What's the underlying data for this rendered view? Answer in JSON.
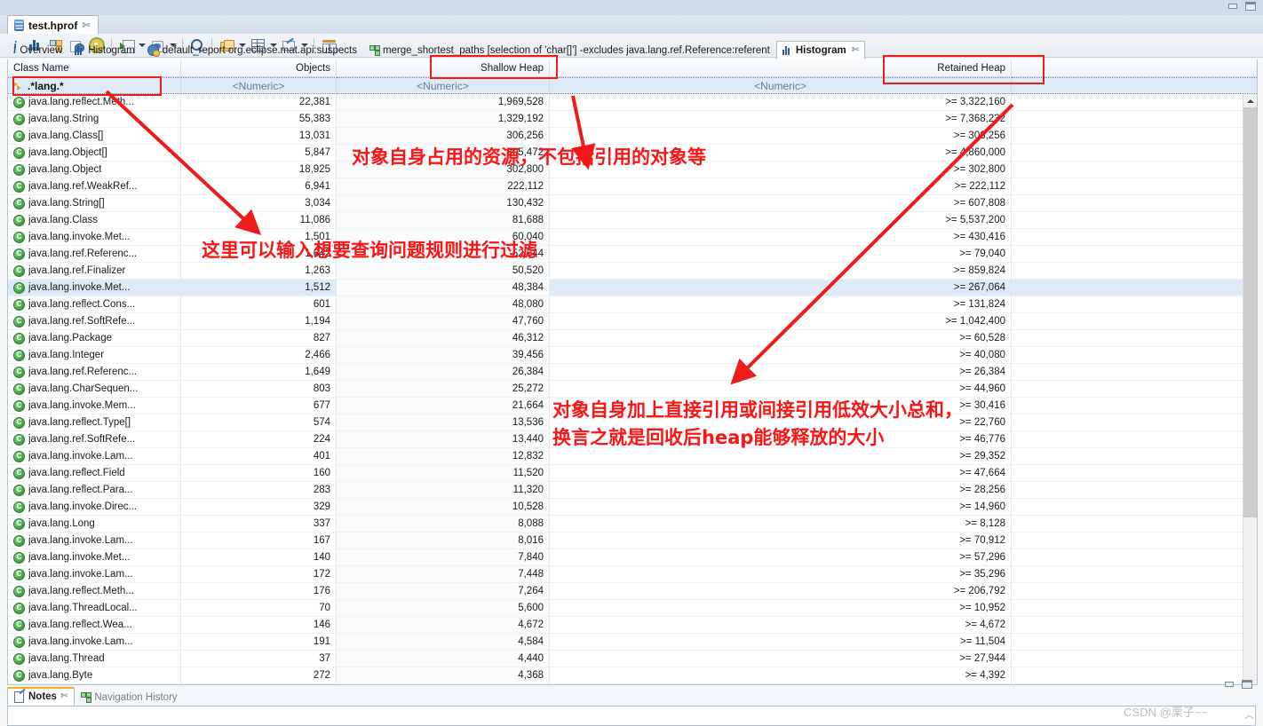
{
  "window": {
    "minimize_label": "minimize",
    "maximize_label": "maximize"
  },
  "editor_tab": {
    "title": "test.hprof",
    "close_glyph": "✄"
  },
  "toolbar": {
    "items": [
      {
        "name": "overview-info",
        "label": "i"
      },
      {
        "name": "histogram",
        "label": "Histogram"
      },
      {
        "name": "dominator-tree",
        "label": "Dominator Tree"
      },
      {
        "name": "oql",
        "label": "OQL"
      },
      {
        "name": "leak-suspects",
        "label": "Leak Suspects"
      },
      {
        "name": "run-expert-system",
        "label": "Run Expert System Test"
      },
      {
        "name": "query-browser",
        "label": "Query Browser"
      },
      {
        "name": "find-object",
        "label": "Find Object by Address"
      },
      {
        "name": "group-by",
        "label": "Group by"
      },
      {
        "name": "calculate-retained",
        "label": "Calculate Retained Size"
      },
      {
        "name": "export",
        "label": "Export"
      },
      {
        "name": "compare",
        "label": "Compare to another Heap Dump"
      }
    ]
  },
  "view_tabs": [
    {
      "label": "Overview",
      "icon": "info-icon",
      "selected": false,
      "closable": false
    },
    {
      "label": "Histogram",
      "icon": "histogram-icon",
      "selected": false,
      "closable": false
    },
    {
      "label": "default_report org.eclipse.mat.api:suspects",
      "icon": "report-icon",
      "selected": false,
      "closable": false
    },
    {
      "label": "merge_shortest_paths [selection of 'char[]'] -excludes java.lang.ref.Reference:referent",
      "icon": "tree-icon",
      "selected": false,
      "closable": false
    },
    {
      "label": "Histogram",
      "icon": "histogram-icon",
      "selected": true,
      "closable": true,
      "close_glyph": "✄"
    }
  ],
  "table": {
    "columns": [
      "Class Name",
      "Objects",
      "Shallow Heap",
      "Retained Heap",
      ""
    ],
    "filter_row": {
      "class_name": ".*lang.*",
      "objects": "<Numeric>",
      "shallow": "<Numeric>",
      "retained": "<Numeric>"
    },
    "rows": [
      {
        "class": "java.lang.reflect.Meth...",
        "objects": "22,381",
        "shallow": "1,969,528",
        "retained": ">= 3,322,160",
        "selected": false
      },
      {
        "class": "java.lang.String",
        "objects": "55,383",
        "shallow": "1,329,192",
        "retained": ">= 7,368,232",
        "selected": false
      },
      {
        "class": "java.lang.Class[]",
        "objects": "13,031",
        "shallow": "306,256",
        "retained": ">= 306,256",
        "selected": false
      },
      {
        "class": "java.lang.Object[]",
        "objects": "5,847",
        "shallow": "305,472",
        "retained": ">= 4,860,000",
        "selected": false
      },
      {
        "class": "java.lang.Object",
        "objects": "18,925",
        "shallow": "302,800",
        "retained": ">= 302,800",
        "selected": false
      },
      {
        "class": "java.lang.ref.WeakRef...",
        "objects": "6,941",
        "shallow": "222,112",
        "retained": ">= 222,112",
        "selected": false
      },
      {
        "class": "java.lang.String[]",
        "objects": "3,034",
        "shallow": "130,432",
        "retained": ">= 607,808",
        "selected": false
      },
      {
        "class": "java.lang.Class",
        "objects": "11,086",
        "shallow": "81,688",
        "retained": ">= 5,537,200",
        "selected": false
      },
      {
        "class": "java.lang.invoke.Met...",
        "objects": "1,501",
        "shallow": "60,040",
        "retained": ">= 430,416",
        "selected": false
      },
      {
        "class": "java.lang.ref.Referenc...",
        "objects": "1,642",
        "shallow": "52,544",
        "retained": ">= 79,040",
        "selected": false
      },
      {
        "class": "java.lang.ref.Finalizer",
        "objects": "1,263",
        "shallow": "50,520",
        "retained": ">= 859,824",
        "selected": false
      },
      {
        "class": "java.lang.invoke.Met...",
        "objects": "1,512",
        "shallow": "48,384",
        "retained": ">= 267,064",
        "selected": true
      },
      {
        "class": "java.lang.reflect.Cons...",
        "objects": "601",
        "shallow": "48,080",
        "retained": ">= 131,824",
        "selected": false
      },
      {
        "class": "java.lang.ref.SoftRefe...",
        "objects": "1,194",
        "shallow": "47,760",
        "retained": ">= 1,042,400",
        "selected": false
      },
      {
        "class": "java.lang.Package",
        "objects": "827",
        "shallow": "46,312",
        "retained": ">= 60,528",
        "selected": false
      },
      {
        "class": "java.lang.Integer",
        "objects": "2,466",
        "shallow": "39,456",
        "retained": ">= 40,080",
        "selected": false
      },
      {
        "class": "java.lang.ref.Referenc...",
        "objects": "1,649",
        "shallow": "26,384",
        "retained": ">= 26,384",
        "selected": false
      },
      {
        "class": "java.lang.CharSequen...",
        "objects": "803",
        "shallow": "25,272",
        "retained": ">= 44,960",
        "selected": false
      },
      {
        "class": "java.lang.invoke.Mem...",
        "objects": "677",
        "shallow": "21,664",
        "retained": ">= 30,416",
        "selected": false
      },
      {
        "class": "java.lang.reflect.Type[]",
        "objects": "574",
        "shallow": "13,536",
        "retained": ">= 22,760",
        "selected": false
      },
      {
        "class": "java.lang.ref.SoftRefe...",
        "objects": "224",
        "shallow": "13,440",
        "retained": ">= 46,776",
        "selected": false
      },
      {
        "class": "java.lang.invoke.Lam...",
        "objects": "401",
        "shallow": "12,832",
        "retained": ">= 29,352",
        "selected": false
      },
      {
        "class": "java.lang.reflect.Field",
        "objects": "160",
        "shallow": "11,520",
        "retained": ">= 47,664",
        "selected": false
      },
      {
        "class": "java.lang.reflect.Para...",
        "objects": "283",
        "shallow": "11,320",
        "retained": ">= 28,256",
        "selected": false
      },
      {
        "class": "java.lang.invoke.Direc...",
        "objects": "329",
        "shallow": "10,528",
        "retained": ">= 14,960",
        "selected": false
      },
      {
        "class": "java.lang.Long",
        "objects": "337",
        "shallow": "8,088",
        "retained": ">= 8,128",
        "selected": false
      },
      {
        "class": "java.lang.invoke.Lam...",
        "objects": "167",
        "shallow": "8,016",
        "retained": ">= 70,912",
        "selected": false
      },
      {
        "class": "java.lang.invoke.Met...",
        "objects": "140",
        "shallow": "7,840",
        "retained": ">= 57,296",
        "selected": false
      },
      {
        "class": "java.lang.invoke.Lam...",
        "objects": "172",
        "shallow": "7,448",
        "retained": ">= 35,296",
        "selected": false
      },
      {
        "class": "java.lang.reflect.Meth...",
        "objects": "176",
        "shallow": "7,264",
        "retained": ">= 206,792",
        "selected": false
      },
      {
        "class": "java.lang.ThreadLocal...",
        "objects": "70",
        "shallow": "5,600",
        "retained": ">= 10,952",
        "selected": false
      },
      {
        "class": "java.lang.reflect.Wea...",
        "objects": "146",
        "shallow": "4,672",
        "retained": ">= 4,672",
        "selected": false
      },
      {
        "class": "java.lang.invoke.Lam...",
        "objects": "191",
        "shallow": "4,584",
        "retained": ">= 11,504",
        "selected": false
      },
      {
        "class": "java.lang.Thread",
        "objects": "37",
        "shallow": "4,440",
        "retained": ">= 27,944",
        "selected": false
      },
      {
        "class": "java.lang.Byte",
        "objects": "272",
        "shallow": "4,368",
        "retained": ">= 4,392",
        "selected": false
      }
    ]
  },
  "bottom_tabs": [
    {
      "label": "Notes",
      "icon": "notes-icon",
      "selected": true,
      "close_glyph": "✄"
    },
    {
      "label": "Navigation History",
      "icon": "nav-history-icon",
      "selected": false
    }
  ],
  "annotations": {
    "color": "#fb1414",
    "shallow_heap_note": "对象自身占用的资源，不包括引用的对象等",
    "filter_note": "这里可以输入想要查询问题规则进行过滤",
    "retained_note_line1": "对象自身加上直接引用或间接引用低效大小总和，",
    "retained_note_line2": "换言之就是回收后heap能够释放的大小"
  },
  "watermark": "CSDN @栗子~~"
}
